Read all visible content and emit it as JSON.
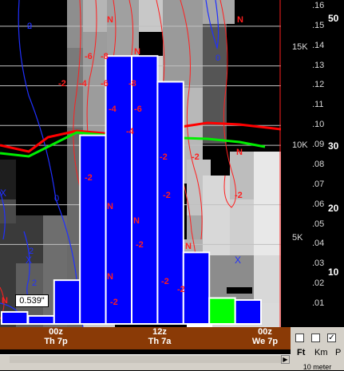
{
  "chart_data": {
    "type": "bar",
    "bar_color": "#0000ff",
    "bar_edge": "#ffffff",
    "precip_bars": [
      {
        "x": 0,
        "value": 0.006
      },
      {
        "x": 1,
        "value": 0.004
      },
      {
        "x": 2,
        "value": 0.022
      },
      {
        "x": 3,
        "value": 0.095
      },
      {
        "x": 4,
        "value": 0.135
      },
      {
        "x": 5,
        "value": 0.135
      },
      {
        "x": 6,
        "value": 0.122
      },
      {
        "x": 7,
        "value": 0.036
      },
      {
        "x": 8,
        "value": 0.013
      },
      {
        "x": 9,
        "value": 0.012
      }
    ],
    "precip_highlight": {
      "x": 8,
      "value": 0.013,
      "color": "#00ff00"
    },
    "right_ticks": [
      ".16",
      ".15",
      ".14",
      ".13",
      ".12",
      ".11",
      ".10",
      ".09",
      ".08",
      ".07",
      ".06",
      ".05",
      ".04",
      ".03",
      ".02",
      ".01"
    ],
    "right_tick_values": [
      0.16,
      0.15,
      0.14,
      0.13,
      0.12,
      0.11,
      0.1,
      0.09,
      0.08,
      0.07,
      0.06,
      0.05,
      0.04,
      0.03,
      0.02,
      0.01
    ],
    "height_labels": [
      "15K",
      "10K",
      "5K"
    ],
    "height_label_values": [
      15000,
      10000,
      5000
    ],
    "level_labels": [
      "50",
      "30",
      "20",
      "10"
    ],
    "level_label_values": [
      50,
      30,
      20,
      10
    ],
    "gridlines": [
      0.15,
      0.13,
      0.12,
      0.1,
      0.09,
      0.06,
      0.04
    ],
    "red_contour_labels": [
      "N",
      "N",
      "-6",
      "-8",
      "-2",
      "-4",
      "-6",
      "-8",
      "-4",
      "-6",
      "-4",
      "-2",
      "-2",
      "-2",
      "N",
      "N",
      "-2",
      "N",
      "N",
      "N",
      "-2",
      "-2",
      "-2",
      "N",
      "-2",
      "N",
      "-2"
    ],
    "blue_contour_labels": [
      "0",
      "0",
      "2",
      "2",
      "0",
      "2"
    ],
    "x_markers": [
      "X",
      "X",
      "X"
    ],
    "time_labels": [
      {
        "hour": "00z",
        "day": "Th 7p"
      },
      {
        "hour": "12z",
        "day": "Th 7a"
      },
      {
        "hour": "00z",
        "day": "We 7p"
      }
    ],
    "readout_value": "0.539\""
  },
  "controls": {
    "units": [
      "Ft",
      "Km",
      "P"
    ],
    "active_unit": "Ft",
    "checkbox_states": [
      false,
      false,
      true
    ],
    "footer": "10 meter"
  }
}
